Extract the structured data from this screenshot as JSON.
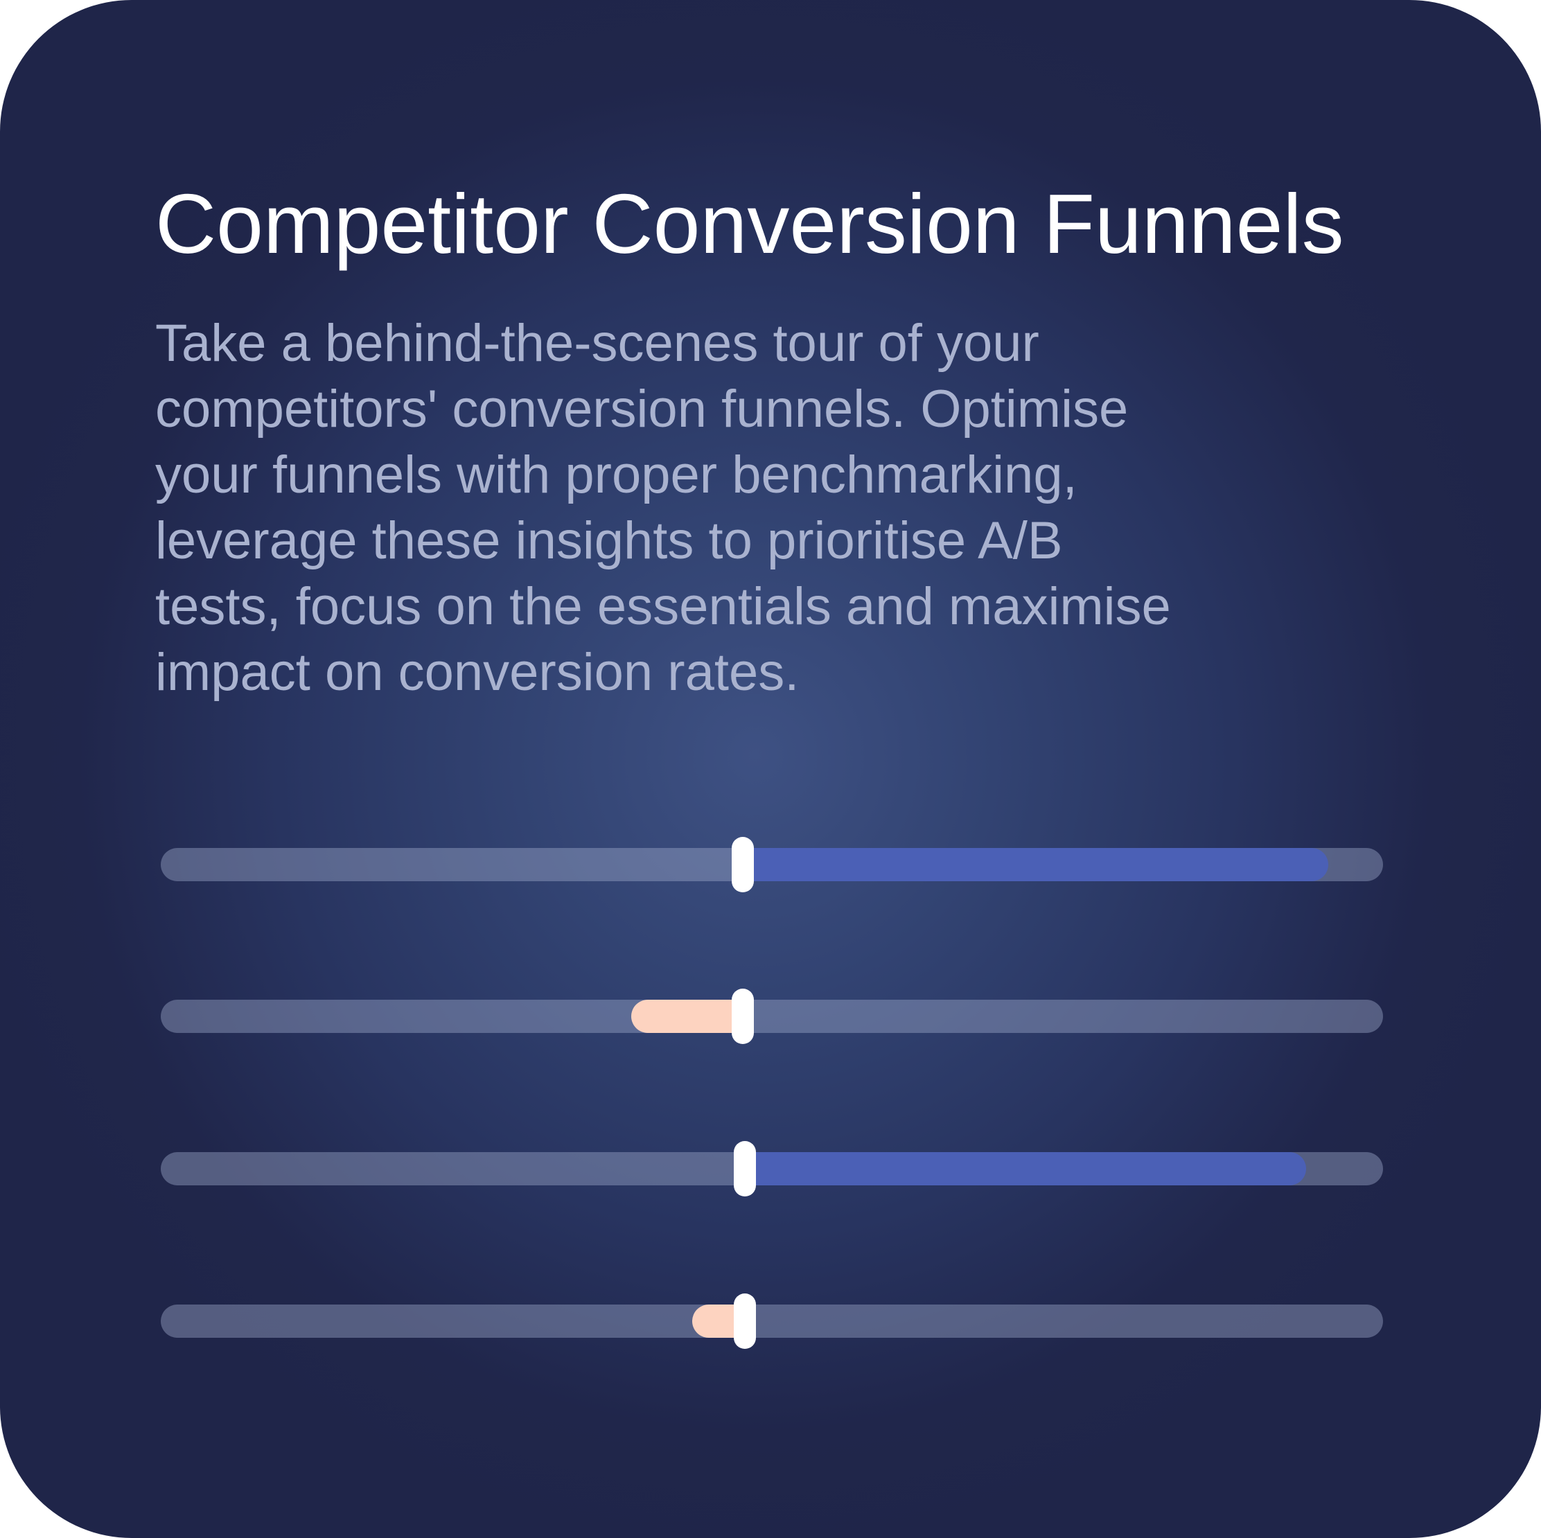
{
  "card": {
    "title": "Competitor Conversion Funnels",
    "description_lines": [
      "Take a behind-the-scenes tour of your",
      "competitors' conversion funnels. Optimise",
      "your funnels with proper benchmarking,",
      "leverage these insights to prioritise A/B",
      "tests, focus on the essentials and maximise",
      "impact on conversion rates."
    ]
  },
  "colors": {
    "background_center": "#3e5183",
    "background_edge": "#1f2549",
    "title": "#ffffff",
    "description": "#a9b2cf",
    "positive_fill": "#4b60b6",
    "negative_fill": "#fdd3c0",
    "thumb": "#ffffff"
  },
  "sliders": [
    {
      "name": "funnel-slider-1",
      "value": 0.476,
      "fill_from": 0.476,
      "fill_to": 0.955,
      "direction": "positive"
    },
    {
      "name": "funnel-slider-2",
      "value": 0.476,
      "fill_from": 0.385,
      "fill_to": 0.476,
      "direction": "negative"
    },
    {
      "name": "funnel-slider-3",
      "value": 0.478,
      "fill_from": 0.478,
      "fill_to": 0.937,
      "direction": "positive"
    },
    {
      "name": "funnel-slider-4",
      "value": 0.478,
      "fill_from": 0.435,
      "fill_to": 0.478,
      "direction": "negative"
    }
  ]
}
